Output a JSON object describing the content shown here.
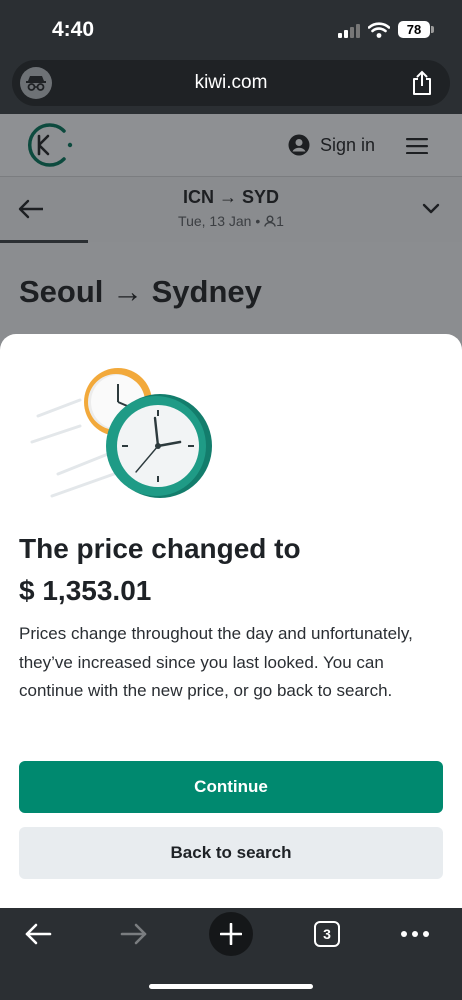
{
  "status_bar": {
    "time": "4:40",
    "battery": "78"
  },
  "browser": {
    "url": "kiwi.com",
    "tab_count": "3"
  },
  "site": {
    "signin_label": "Sign in",
    "route_title": "ICN → SYD",
    "route_sub": "Tue, 13 Jan • ",
    "passenger_count": "1",
    "page_title": "Seoul → Sydney"
  },
  "modal": {
    "title_line1": "The price changed to",
    "title_line2": "$ 1,353.01",
    "body": "Prices change throughout the day and unfortunately, they’ve increased since you last looked. You can continue with the new price, or go back to search.",
    "continue_label": "Continue",
    "back_label": "Back to search"
  },
  "colors": {
    "accent": "#00896f",
    "secondary_button": "#e8ecef",
    "clock_front": "#1f9b86",
    "clock_back": "#f2a93b"
  }
}
